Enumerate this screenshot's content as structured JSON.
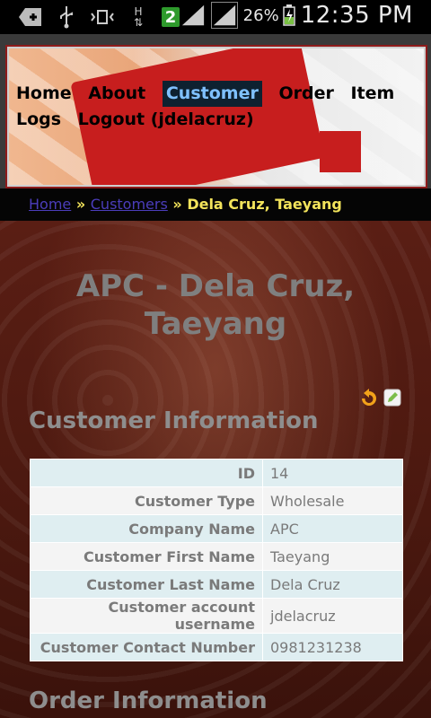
{
  "status_bar": {
    "battery_percent": "26%",
    "time": "12:35 PM",
    "sim_badge": "2",
    "network_label": "H"
  },
  "nav": {
    "items": [
      "Home",
      "About",
      "Customer",
      "Order",
      "Item",
      "Logs"
    ],
    "logout": "Logout (jdelacruz)",
    "active": "Customer"
  },
  "breadcrumb": {
    "home": "Home",
    "sep1": "»",
    "customers": "Customers",
    "sep2": "»",
    "current": "Dela Cruz, Taeyang"
  },
  "page": {
    "title_line1": "APC - Dela Cruz,",
    "title_line2": "Taeyang",
    "customer_section": "Customer Information",
    "order_section": "Order Information"
  },
  "customer": [
    {
      "label": "ID",
      "value": "14"
    },
    {
      "label": "Customer Type",
      "value": "Wholesale"
    },
    {
      "label": "Company Name",
      "value": "APC"
    },
    {
      "label": "Customer First Name",
      "value": "Taeyang"
    },
    {
      "label": "Customer Last Name",
      "value": "Dela Cruz"
    },
    {
      "label": "Customer account username",
      "value": "jdelacruz"
    },
    {
      "label": "Customer Contact Number",
      "value": "0981231238"
    }
  ],
  "icons": {
    "back": "arrow-back-icon",
    "edit": "edit-icon"
  }
}
